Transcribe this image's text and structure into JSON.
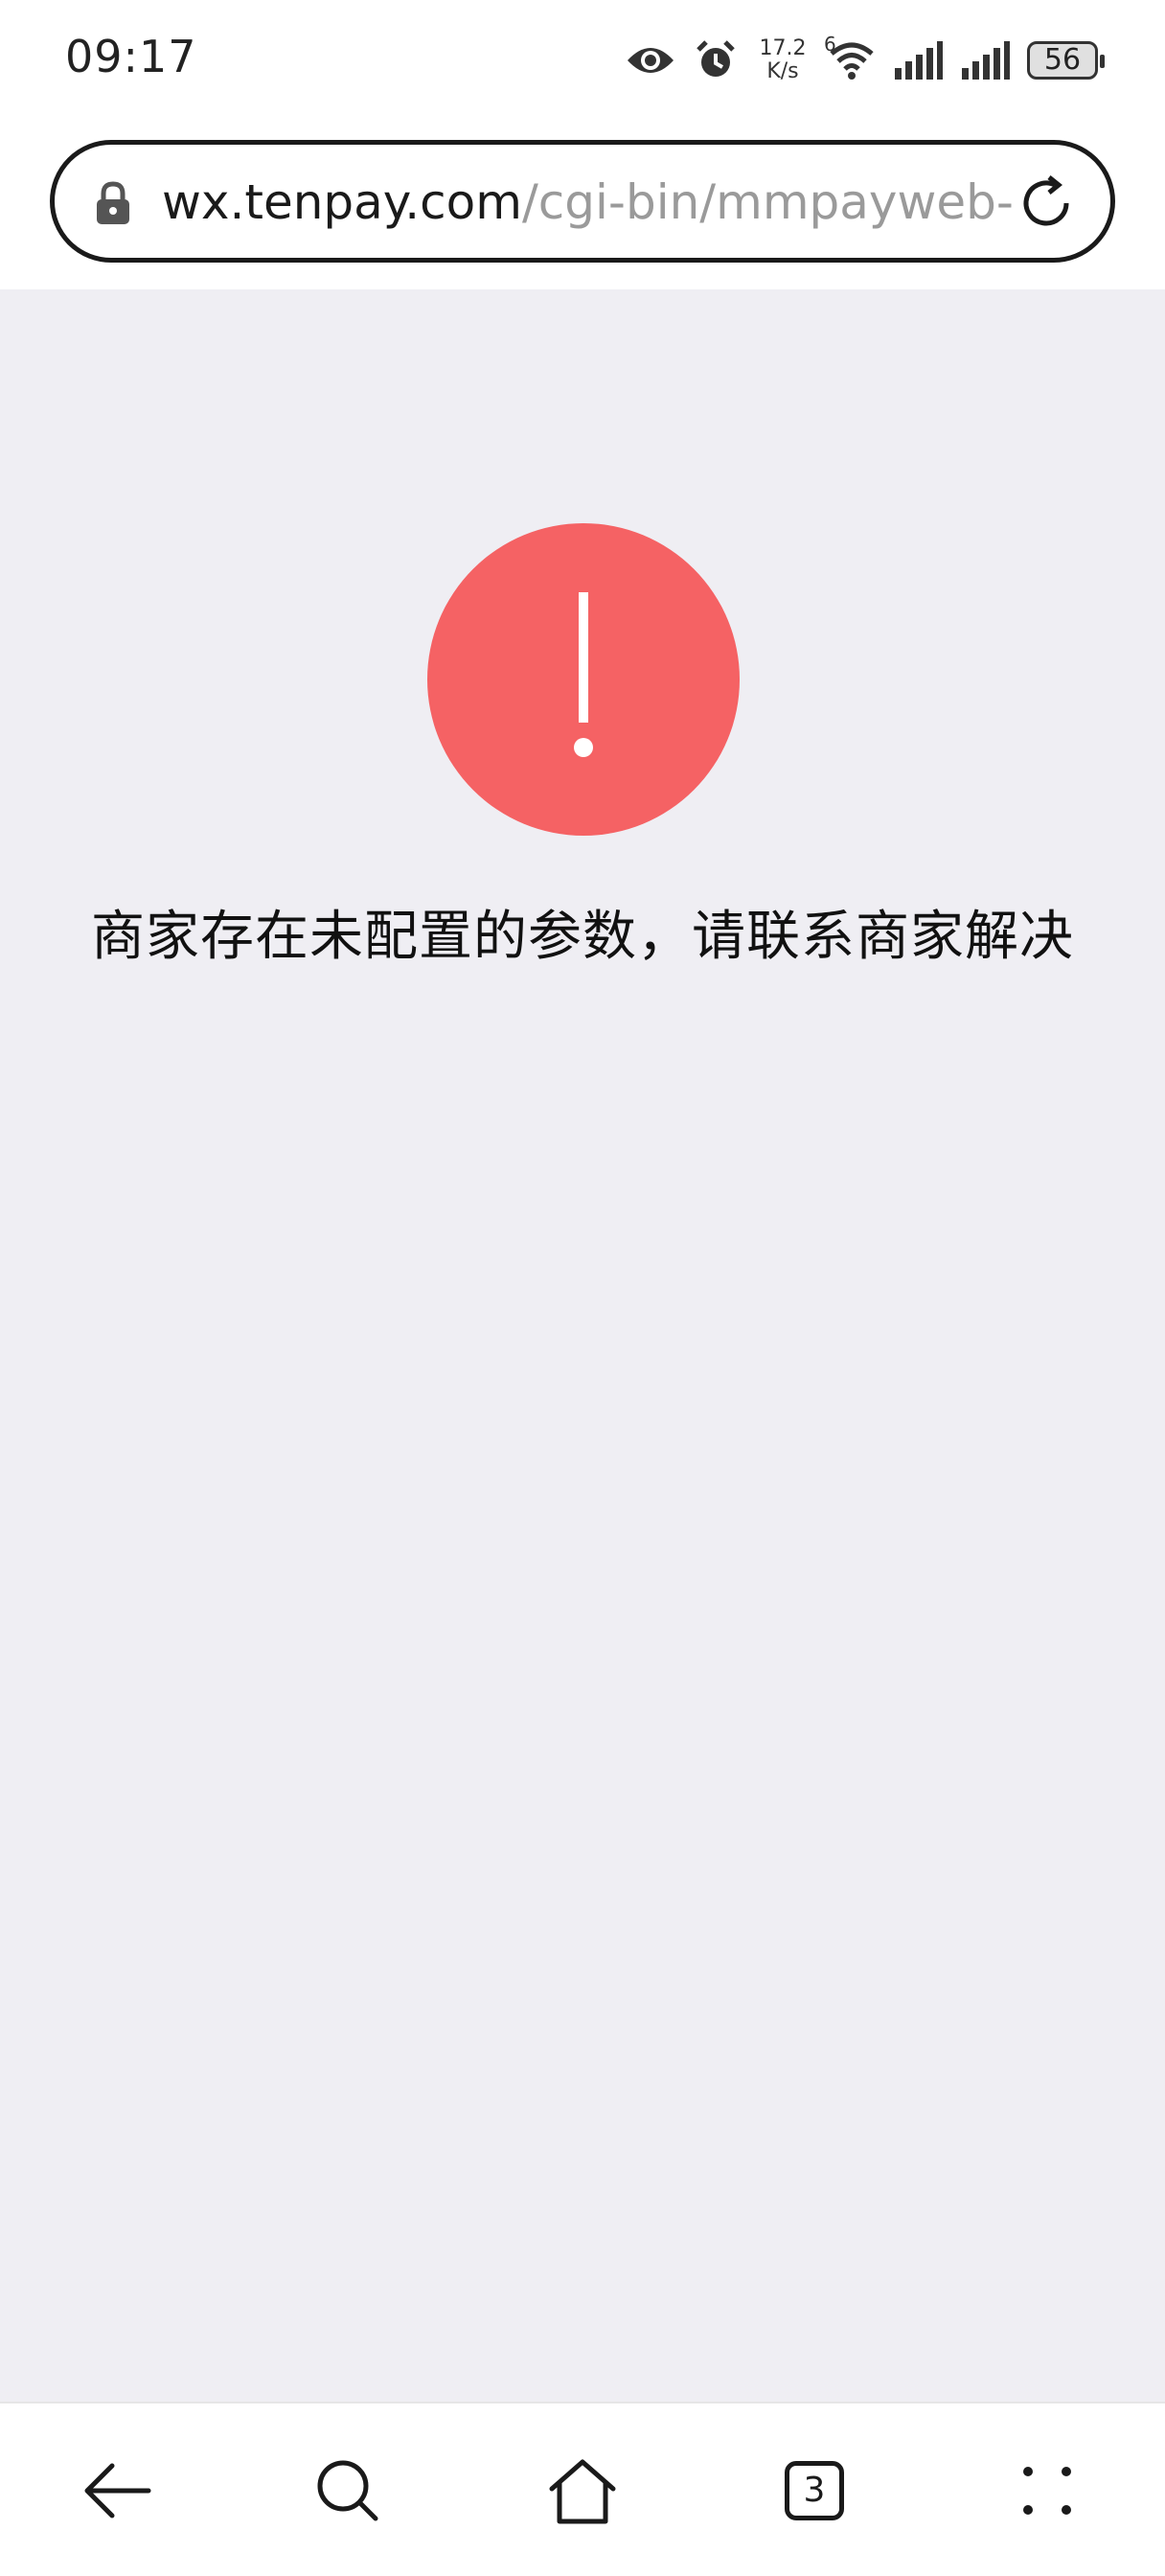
{
  "status_bar": {
    "time": "09:17",
    "net_speed_value": "17.2",
    "net_speed_unit": "K/s",
    "wifi_label": "6",
    "battery_level": "56",
    "icons": [
      "eye-icon",
      "alarm-icon",
      "wifi-icon",
      "signal-icon",
      "signal-icon",
      "battery-icon"
    ]
  },
  "address_bar": {
    "host": "wx.tenpay.com",
    "path": "/cgi-bin/mmpayweb-",
    "icons": [
      "lock-icon",
      "refresh-icon"
    ]
  },
  "error": {
    "icon": "exclamation-icon",
    "icon_color": "#f56264",
    "message": "商家存在未配置的参数，请联系商家解决"
  },
  "bottom_nav": {
    "tab_count": "3",
    "items": [
      "back-icon",
      "search-icon",
      "home-icon",
      "tabs-icon",
      "menu-icon"
    ]
  },
  "colors": {
    "page_background": "#efeef3",
    "accent_error": "#f56264"
  }
}
